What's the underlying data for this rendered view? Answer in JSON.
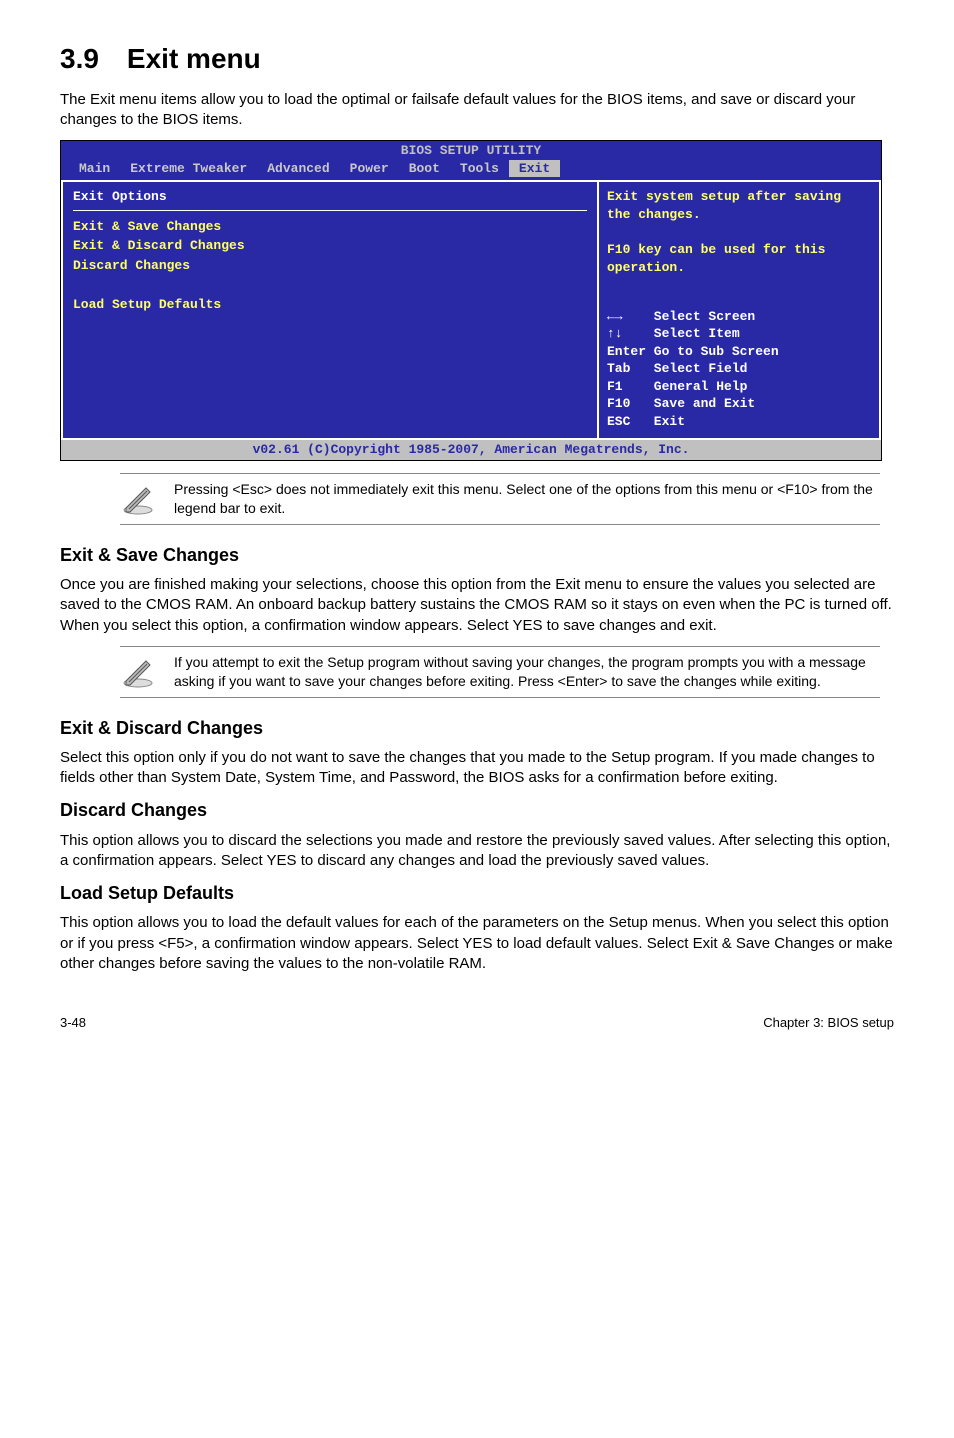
{
  "heading": "3.9 Exit menu",
  "intro": "The Exit menu items allow you to load the optimal or failsafe default values for the BIOS items, and save or discard your changes to the BIOS items.",
  "bios": {
    "title": "BIOS SETUP UTILITY",
    "tabs": [
      "Main",
      "Extreme Tweaker",
      "Advanced",
      "Power",
      "Boot",
      "Tools",
      "Exit"
    ],
    "active_tab": "Exit",
    "panel_header": "Exit Options",
    "options": [
      "Exit & Save Changes",
      "Exit & Discard Changes",
      "Discard Changes",
      "",
      "Load Setup Defaults"
    ],
    "help": "Exit system setup after saving the changes.\n\nF10 key can be used for this operation.",
    "keys": [
      {
        "k": "←→",
        "d": "Select Screen"
      },
      {
        "k": "↑↓",
        "d": "Select Item"
      },
      {
        "k": "Enter",
        "d": "Go to Sub Screen"
      },
      {
        "k": "Tab",
        "d": "Select Field"
      },
      {
        "k": "F1",
        "d": "General Help"
      },
      {
        "k": "F10",
        "d": "Save and Exit"
      },
      {
        "k": "ESC",
        "d": "Exit"
      }
    ],
    "footer": "v02.61 (C)Copyright 1985-2007, American Megatrends, Inc."
  },
  "note1": "Pressing <Esc> does not immediately exit this menu. Select one of the options from this menu or <F10> from the legend bar to exit.",
  "sections": {
    "s1_h": "Exit & Save Changes",
    "s1_p": "Once you are finished making your selections, choose this option from the Exit menu to ensure the values you selected are saved to the CMOS RAM. An onboard backup battery sustains the CMOS RAM so it stays on even when the PC is turned off. When you select this option, a confirmation window appears. Select YES to save changes and exit.",
    "note2": " If you attempt to exit the Setup program without saving your changes, the program prompts you with a message asking if you want to save your changes before exiting. Press <Enter>  to save the changes while exiting.",
    "s2_h": "Exit & Discard Changes",
    "s2_p": "Select this option only if you do not want to save the changes that you  made to the Setup program. If you made changes to fields other than System Date, System Time, and Password, the BIOS asks for a confirmation before exiting.",
    "s3_h": "Discard Changes",
    "s3_p": "This option allows you to discard the selections you made and restore the previously saved values. After selecting this option, a confirmation appears. Select YES to discard any changes and load the previously saved values.",
    "s4_h": "Load Setup Defaults",
    "s4_p": "This option allows you to load the default values for each of the parameters on the Setup menus. When you select this option or if you press <F5>, a confirmation window appears. Select YES to load default values. Select Exit & Save Changes or make other changes before saving the values to the non-volatile RAM."
  },
  "footer_left": "3-48",
  "footer_right": "Chapter 3: BIOS setup"
}
